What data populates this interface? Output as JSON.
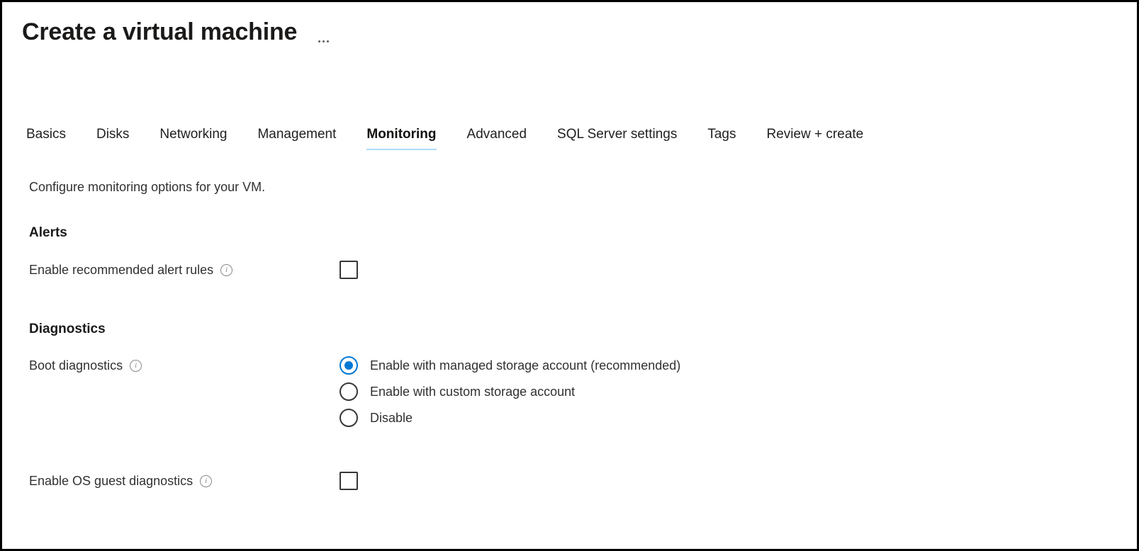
{
  "header": {
    "title": "Create a virtual machine",
    "more_menu_label": "...",
    "more_menu_icon": "ellipsis-icon"
  },
  "tabs": [
    {
      "label": "Basics",
      "active": false
    },
    {
      "label": "Disks",
      "active": false
    },
    {
      "label": "Networking",
      "active": false
    },
    {
      "label": "Management",
      "active": false
    },
    {
      "label": "Monitoring",
      "active": true
    },
    {
      "label": "Advanced",
      "active": false
    },
    {
      "label": "SQL Server settings",
      "active": false
    },
    {
      "label": "Tags",
      "active": false
    },
    {
      "label": "Review + create",
      "active": false
    }
  ],
  "main": {
    "subtitle": "Configure monitoring options for your VM.",
    "sections": {
      "alerts": {
        "heading": "Alerts",
        "alert_rules": {
          "label": "Enable recommended alert rules",
          "info_icon": "info-icon",
          "checked": false
        }
      },
      "diagnostics": {
        "heading": "Diagnostics",
        "boot_diagnostics": {
          "label": "Boot diagnostics",
          "info_icon": "info-icon",
          "selected": "Enable with managed storage account (recommended)",
          "options": [
            {
              "label": "Enable with managed storage account (recommended)",
              "checked": true
            },
            {
              "label": "Enable with custom storage account",
              "checked": false
            },
            {
              "label": "Disable",
              "checked": false
            }
          ]
        },
        "os_guest_diagnostics": {
          "label": "Enable OS guest diagnostics",
          "info_icon": "info-icon",
          "checked": false
        }
      }
    }
  },
  "colors": {
    "accent": "#0078d4",
    "tab_underline": "#addcf5",
    "text": "#323130",
    "heading": "#1b1a19",
    "border": "#393736",
    "muted": "#8a8886"
  }
}
